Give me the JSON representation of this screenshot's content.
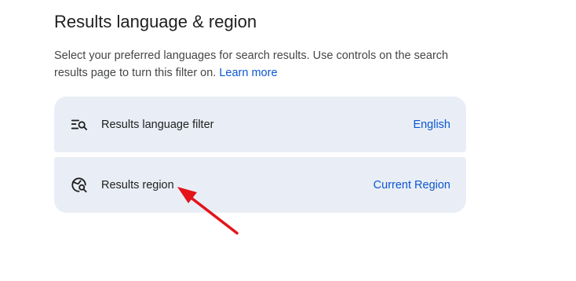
{
  "section": {
    "title": "Results language & region",
    "description": "Select your preferred languages for search results. Use controls on the search results page to turn this filter on.",
    "learn_more": "Learn more"
  },
  "settings": [
    {
      "icon": "language-filter-icon",
      "label": "Results language filter",
      "value": "English"
    },
    {
      "icon": "region-search-icon",
      "label": "Results region",
      "value": "Current Region"
    }
  ],
  "colors": {
    "card_background": "#e9eef6",
    "link": "#0b57d0",
    "annotation_arrow": "#e3141a"
  },
  "annotation": {
    "icon": "red-arrow-icon",
    "target": "Results region"
  }
}
